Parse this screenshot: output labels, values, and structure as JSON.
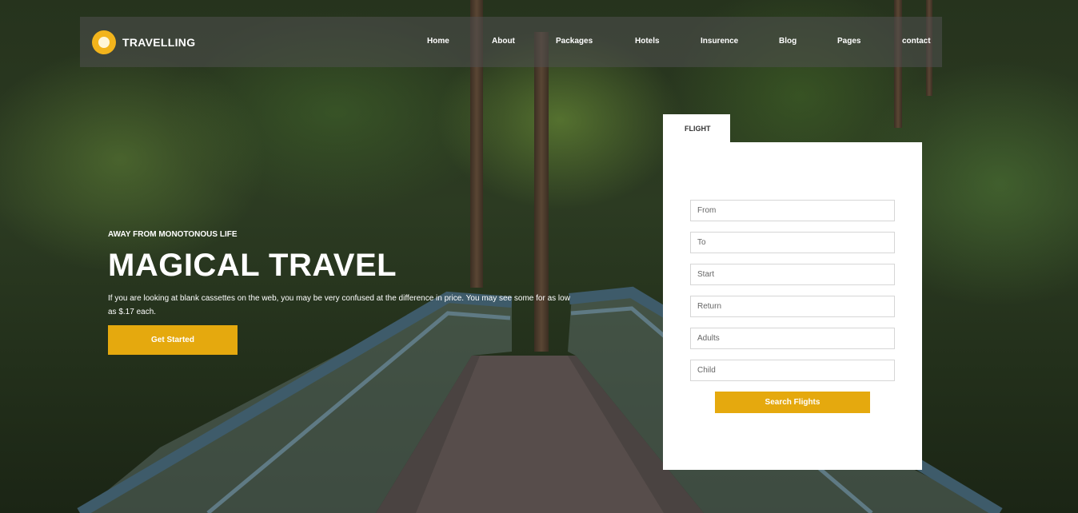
{
  "brand": {
    "name": "TRAVELLING"
  },
  "nav": {
    "items": [
      {
        "label": "Home"
      },
      {
        "label": "About"
      },
      {
        "label": "Packages"
      },
      {
        "label": "Hotels"
      },
      {
        "label": "Insurence"
      },
      {
        "label": "Blog"
      },
      {
        "label": "Pages"
      },
      {
        "label": "contact"
      }
    ]
  },
  "hero": {
    "tagline": "AWAY FROM MONOTONOUS LIFE",
    "title": "MAGICAL TRAVEL",
    "description": "If you are looking at blank cassettes on the web, you may be very confused at the difference in price. You may see some for as low as $.17 each.",
    "cta_label": "Get Started"
  },
  "booking": {
    "tab_label": "FLIGHT",
    "fields": [
      {
        "placeholder": "From"
      },
      {
        "placeholder": "To"
      },
      {
        "placeholder": "Start"
      },
      {
        "placeholder": "Return"
      },
      {
        "placeholder": "Adults"
      },
      {
        "placeholder": "Child"
      }
    ],
    "submit_label": "Search Flights"
  },
  "colors": {
    "accent": "#e5a90e",
    "logo": "#f2b41c"
  }
}
